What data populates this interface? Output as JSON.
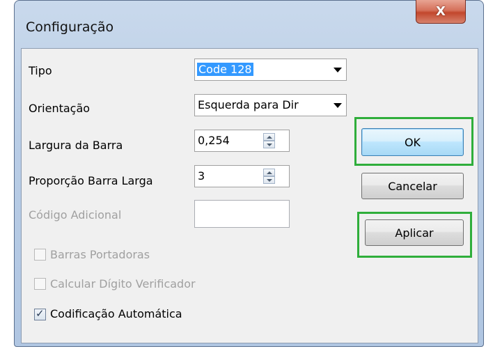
{
  "window": {
    "title": "Configuração",
    "close_glyph": "X"
  },
  "fields": {
    "tipo": {
      "label": "Tipo",
      "value": "Code 128"
    },
    "orientacao": {
      "label": "Orientação",
      "value": "Esquerda para Dir"
    },
    "largura": {
      "label": "Largura da Barra",
      "value": "0,254"
    },
    "proporcao": {
      "label": "Proporção Barra Larga",
      "value": "3"
    },
    "codigo_adicional": {
      "label": "Código Adicional",
      "value": ""
    }
  },
  "checkboxes": [
    {
      "label": "Barras Portadoras",
      "checked": false,
      "enabled": false
    },
    {
      "label": "Calcular Dígito Verificador",
      "checked": false,
      "enabled": false
    },
    {
      "label": "Codificação Automática",
      "checked": true,
      "enabled": true
    }
  ],
  "buttons": {
    "ok": "OK",
    "cancel": "Cancelar",
    "apply": "Aplicar"
  },
  "colors": {
    "highlight": "#2fae3b",
    "selection": "#3399ff"
  }
}
